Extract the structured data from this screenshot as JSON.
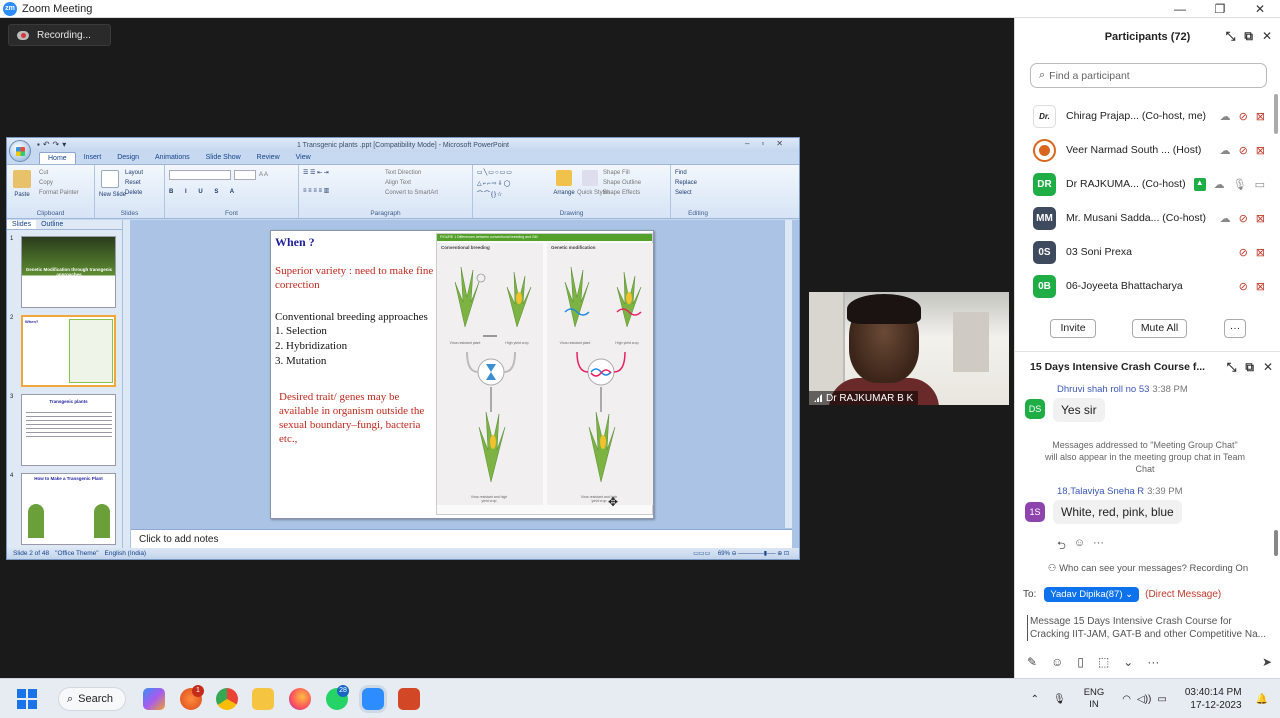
{
  "zoom": {
    "window_title": "Zoom Meeting",
    "logo_text": "zm",
    "recording_label": "Recording..."
  },
  "ppt": {
    "title": "1 Transgenic plants .ppt [Compatibility Mode] - Microsoft PowerPoint",
    "tabs": [
      "Home",
      "Insert",
      "Design",
      "Animations",
      "Slide Show",
      "Review",
      "View"
    ],
    "groups": [
      "Clipboard",
      "Slides",
      "Font",
      "Paragraph",
      "Drawing",
      "Editing"
    ],
    "clipboard": {
      "paste": "Paste",
      "cut": "Cut",
      "copy": "Copy",
      "format_painter": "Format Painter"
    },
    "slides_group": {
      "new_slide": "New Slide",
      "layout": "Layout",
      "reset": "Reset",
      "delete": "Delete"
    },
    "paragraph_group": {
      "text_direction": "Text Direction",
      "align_text": "Align Text",
      "convert": "Convert to SmartArt"
    },
    "drawing_group": {
      "arrange": "Arrange",
      "quick_styles": "Quick Styles",
      "shape_fill": "Shape Fill",
      "shape_outline": "Shape Outline",
      "shape_effects": "Shape Effects"
    },
    "editing_group": {
      "find": "Find",
      "replace": "Replace",
      "select": "Select"
    },
    "pane_tabs": [
      "Slides",
      "Outline"
    ],
    "thumbs": [
      {
        "num": "1",
        "title": "Genetic Modification through transgenic approaches"
      },
      {
        "num": "2",
        "title": "When?"
      },
      {
        "num": "3",
        "title": "Transgenic plants"
      },
      {
        "num": "4",
        "title": "How to Make a Transgenic Plant"
      }
    ],
    "slide": {
      "heading": "When ?",
      "superior": "Superior variety : need to make fine correction",
      "conventional": "Conventional breeding approaches",
      "list": [
        "1.   Selection",
        "2.   Hybridization",
        "3.   Mutation"
      ],
      "desired": "Desired trait/ genes may be available  in organism outside the sexual boundary–fungi, bacteria  etc.,",
      "figure_header": "FIGURE 1  Differences between conventional breeding and GM",
      "col_left": "Conventional breeding",
      "col_right": "Genetic modification",
      "captions": [
        "Virus resistant plant",
        "High yield crop",
        "Virus resistant plant",
        "High yield crop",
        "Virus resistant and high yield crop",
        "Virus resistant and high yield crop"
      ]
    },
    "notes_placeholder": "Click to add notes",
    "status": {
      "slide": "Slide 2 of 48",
      "theme": "\"Office Theme\"",
      "lang": "English (India)",
      "zoom": "69%"
    }
  },
  "video": {
    "name": "Dr RAJKUMAR B K"
  },
  "participants": {
    "header": "Participants (72)",
    "search_placeholder": "Find a participant",
    "list": [
      {
        "initials": "Dr.",
        "name": "Chirag Prajap... (Co-host, me)",
        "color": "#ffffff"
      },
      {
        "initials": "",
        "name": "Veer Narmad South ... (Host)",
        "color": "#d9661f"
      },
      {
        "initials": "DR",
        "name": "Dr RAJKUMA... (Co-host)",
        "color": "#1fae46"
      },
      {
        "initials": "MM",
        "name": "Mr. Musani Sadda... (Co-host)",
        "color": "#3e4a5e"
      },
      {
        "initials": "0S",
        "name": "03 Soni Prexa",
        "color": "#3e4a5e"
      },
      {
        "initials": "0B",
        "name": "06-Joyeeta Bhattacharya",
        "color": "#1fae46"
      }
    ],
    "invite": "Invite",
    "mute_all": "Mute All",
    "more": "···"
  },
  "chat": {
    "header": "15 Days Intensive Crash Course f...",
    "messages": [
      {
        "initials": "DS",
        "sender": "Dhruvi shah roll no 53",
        "time": "3:38 PM",
        "text": "Yes sir",
        "color": "#1fae46"
      },
      {
        "initials": "1S",
        "sender": "18,Talaviya Sneha R",
        "time": "3:39 PM",
        "text": "White, red, pink, blue",
        "color": "#8e44ad"
      }
    ],
    "system_msg": "Messages addressed to \"Meeting Group Chat\" will also appear in the meeting group chat in Team Chat",
    "who_see": "Who can see your messages? Recording On",
    "to_label": "To:",
    "to_recipient": "Yadav Dipika(87)",
    "direct": "(Direct Message)",
    "input_placeholder": "Message 15 Days Intensive Crash Course for Cracking IIT-JAM, GAT-B and other Competitive Na..."
  },
  "taskbar": {
    "search": "Search",
    "badge_teams": "1",
    "badge_whatsapp": "28",
    "lang_top": "ENG",
    "lang_bottom": "IN",
    "time": "03:40:14 PM",
    "date": "17-12-2023"
  }
}
